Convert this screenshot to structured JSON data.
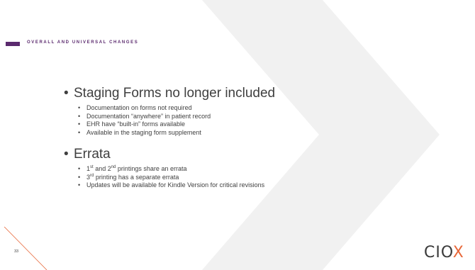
{
  "section_title": "OVERALL AND UNIVERSAL CHANGES",
  "page_number": "33",
  "logo": {
    "main": "CIO",
    "accent": "X"
  },
  "bullets": [
    {
      "label": "Staging Forms no longer included",
      "subitems": [
        "Documentation on forms not required",
        "Documentation “anywhere” in patient record",
        "EHR have “built-in” forms available",
        "Available in the staging form supplement"
      ]
    },
    {
      "label": "Errata",
      "subitems": [
        {
          "a": "1",
          "a_sup": "st",
          "b": " and 2",
          "b_sup": "nd",
          "c": " printings share an errata"
        },
        {
          "a": "3",
          "a_sup": "rd",
          "c": " printing has a separate errata"
        },
        "Updates will be available for Kindle Version for critical revisions"
      ]
    }
  ],
  "colors": {
    "accent": "#5b2a6e",
    "logo_x": "#e8683a",
    "chevron": "#f2f2f2"
  }
}
